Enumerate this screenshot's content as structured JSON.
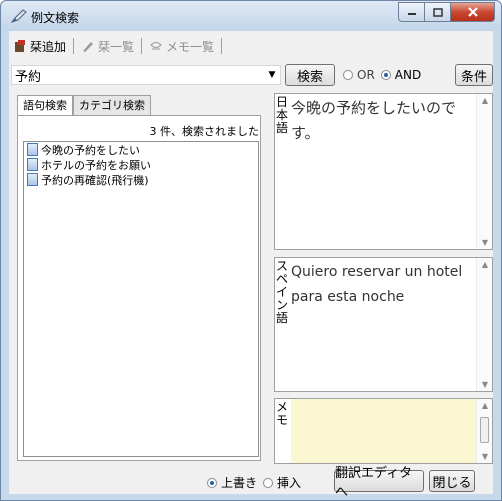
{
  "window": {
    "title": "例文検索",
    "title_icon": "pen-icon",
    "buttons": [
      "minimize",
      "maximize",
      "close"
    ]
  },
  "toolbar": {
    "add_label": "栞追加",
    "bookmark_list_label": "栞一覧",
    "memo_list_label": "メモ一覧"
  },
  "search": {
    "query": "予約",
    "search_button": "検索",
    "or_label": "OR",
    "and_label": "AND",
    "selected_mode": "AND",
    "conditions_button": "条件"
  },
  "tabs": [
    {
      "label": "語句検索",
      "active": true
    },
    {
      "label": "カテゴリ検索",
      "active": false
    }
  ],
  "results": {
    "count_text": "3 件、検索されました",
    "items": [
      {
        "label": "今晩の予約をしたい"
      },
      {
        "label": "ホテルの予約をお願い"
      },
      {
        "label": "予約の再確認(飛行機)"
      }
    ]
  },
  "panes": {
    "japanese": {
      "label": "日本語",
      "text": "今晩の予約をしたいのです。"
    },
    "spanish": {
      "label": "スペイン語",
      "text": "Quiero reservar un hotel para esta noche"
    },
    "memo": {
      "label": "メモ",
      "text": ""
    }
  },
  "bottom": {
    "overwrite_label": "上書き",
    "insert_label": "挿入",
    "selected_mode": "上書き",
    "editor_button": "翻訳エディタへ",
    "close_button": "閉じる"
  },
  "colors": {
    "memo_background": "#fbf7d3",
    "close_button": "#c84832",
    "title_bar": "#c9d9ec"
  }
}
